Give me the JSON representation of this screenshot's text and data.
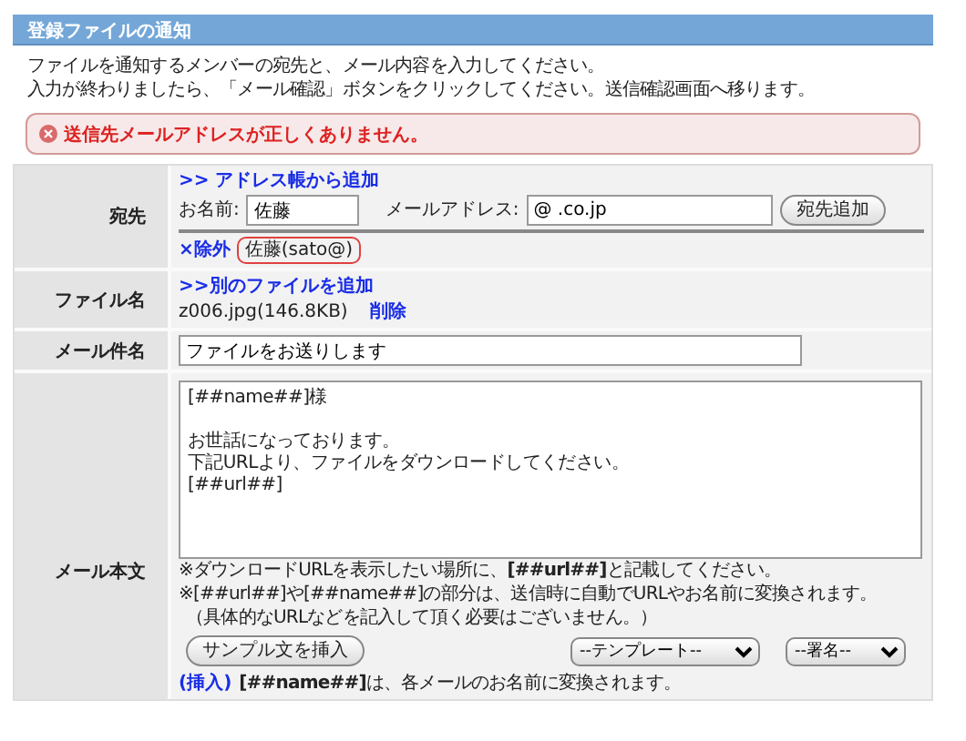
{
  "header": {
    "title": "登録ファイルの通知"
  },
  "intro": [
    "ファイルを通知するメンバーの宛先と、メール内容を入力してください。",
    "入力が終わりましたら、「メール確認」ボタンをクリックしてください。送信確認画面へ移ります。"
  ],
  "error": {
    "message": "送信先メールアドレスが正しくありません。"
  },
  "recipient": {
    "label": "宛先",
    "address_book_link": ">> アドレス帳から追加",
    "name_label": "お名前:",
    "name_value": "佐藤",
    "email_label": "メールアドレス:",
    "email_value": "@ .co.jp",
    "add_button": "宛先追加",
    "entries": [
      {
        "remove_link": "×除外",
        "text": "佐藤(sato@)",
        "highlighted": true
      }
    ]
  },
  "file": {
    "label": "ファイル名",
    "add_link": ">>別のファイルを追加",
    "files": [
      {
        "name": "z006.jpg(146.8KB)",
        "delete_link": "削除"
      }
    ]
  },
  "subject": {
    "label": "メール件名",
    "value": "ファイルをお送りします"
  },
  "body": {
    "label": "メール本文",
    "lines": [
      "[##name##]様",
      "お世話になっております。",
      "下記URLより、ファイルをダウンロードしてください。",
      "[##url##]"
    ],
    "notes": [
      "※ダウンロードURLを表示したい場所に、**[##url##]**と記載してください。",
      "※[##url##]や[##name##]の部分は、送信時に自動でURLやお名前に変換されます。",
      "（具体的なURLなどを記入して頂く必要はございません。）"
    ],
    "sample_button": "サンプル文を挿入",
    "template_select": "--テンプレート--",
    "signature_select": "--署名--",
    "insert_link": "(挿入)",
    "insert_text": "**[##name##]**は、各メールのお名前に変換されます。"
  }
}
